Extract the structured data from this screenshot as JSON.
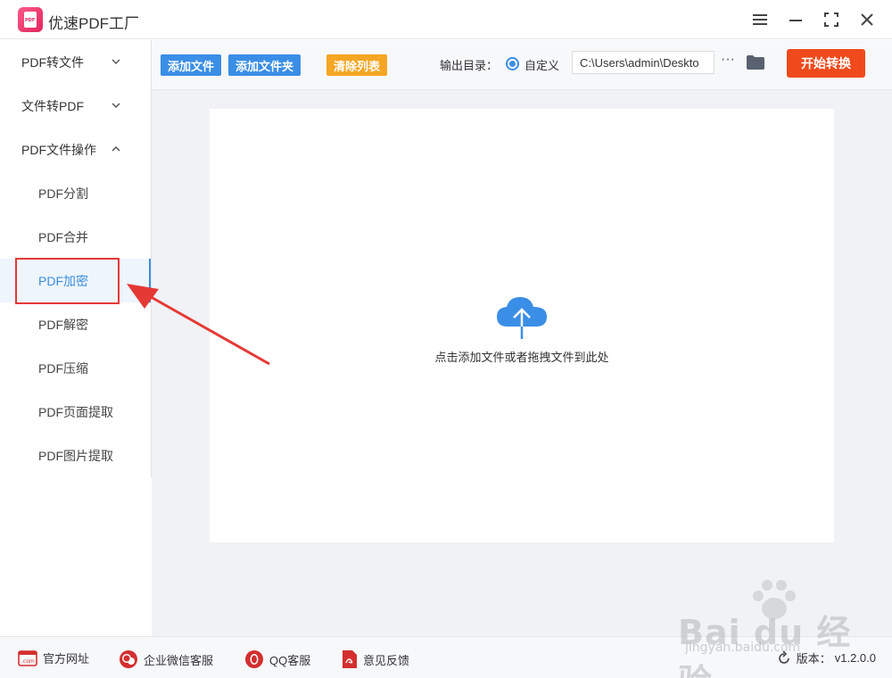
{
  "app": {
    "title": "优速PDF工厂",
    "logo_text": "PDF"
  },
  "sidebar": {
    "groups": [
      {
        "label": "PDF转文件"
      },
      {
        "label": "文件转PDF"
      },
      {
        "label": "PDF文件操作"
      }
    ],
    "items": [
      {
        "label": "PDF分割"
      },
      {
        "label": "PDF合并"
      },
      {
        "label": "PDF加密"
      },
      {
        "label": "PDF解密"
      },
      {
        "label": "PDF压缩"
      },
      {
        "label": "PDF页面提取"
      },
      {
        "label": "PDF图片提取"
      }
    ],
    "active_item": "PDF加密"
  },
  "toolbar": {
    "add_file": "添加文件",
    "add_folder": "添加文件夹",
    "clear_list": "清除列表",
    "output_label": "输出目录：",
    "custom_label": "自定义",
    "path_value": "C:\\Users\\admin\\Deskto",
    "more": "···",
    "start": "开始转换"
  },
  "dropzone": {
    "text": "点击添加文件或者拖拽文件到此处"
  },
  "footer": {
    "links": [
      {
        "label": "官方网址",
        "icon": "web-icon"
      },
      {
        "label": "企业微信客服",
        "icon": "wechat-icon"
      },
      {
        "label": "QQ客服",
        "icon": "qq-icon"
      },
      {
        "label": "意见反馈",
        "icon": "feedback-icon"
      }
    ],
    "version_label": "版本：",
    "version_value": "v1.2.0.0",
    "web_icon_text": ".com"
  },
  "watermark": {
    "text": "Bai du 经验",
    "url": "jingyan.baidu.com"
  },
  "colors": {
    "accent": "#3a8ee6",
    "orange": "#f5a623",
    "start": "#f04a1c",
    "highlight": "#e53935"
  }
}
